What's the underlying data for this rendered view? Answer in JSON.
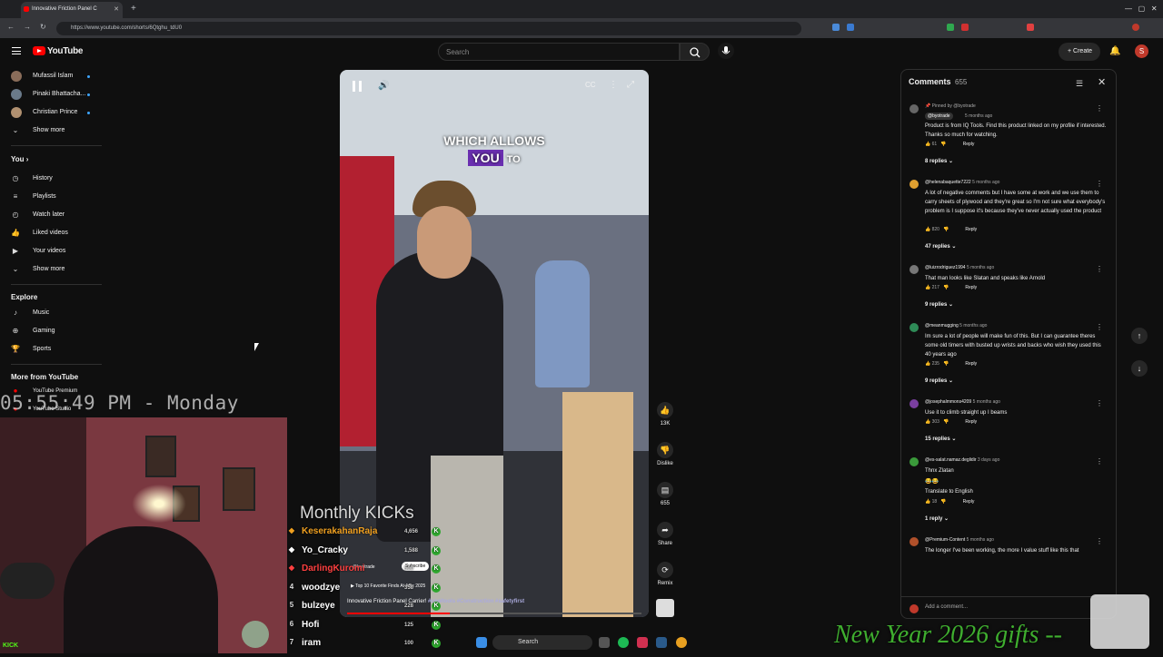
{
  "browser": {
    "tab_title": "Innovative Friction Panel C",
    "url": "https://www.youtube.com/shorts/6Qtghu_tdU0"
  },
  "header": {
    "logo_text": "YouTube",
    "search_placeholder": "Search",
    "create_label": "Create",
    "avatar_letter": "S"
  },
  "sidebar": {
    "subscriptions": [
      {
        "name": "Mufassil Islam",
        "color": "#8a6d5a"
      },
      {
        "name": "Pinaki Bhattacha...",
        "color": "#6a7a8a"
      },
      {
        "name": "Christian Prince",
        "color": "#b09070"
      }
    ],
    "show_more": "Show more",
    "you_heading": "You",
    "you_items": [
      "History",
      "Playlists",
      "Watch later",
      "Liked videos",
      "Your videos",
      "Show more"
    ],
    "explore_heading": "Explore",
    "explore_items": [
      "Music",
      "Gaming",
      "Sports"
    ],
    "more_heading": "More from YouTube",
    "more_items": [
      "YouTube Premium",
      "YouTube Studio"
    ]
  },
  "video": {
    "caption_line1": "WHICH ALLOWS",
    "caption_word": "YOU",
    "caption_word2": "TO",
    "channel": "@byotrade",
    "subscribe": "Subscribe",
    "music": "Top 10 Favorite Finds At Affix 2025",
    "title": "Innovative Friction Panel Carrier!",
    "hashtags": "#cooltools #Construction #safetyfirst",
    "progress": 0.35
  },
  "actions": {
    "like_count": "13K",
    "dislike_label": "Dislike",
    "comment_count": "655",
    "share_label": "Share",
    "remix_label": "Remix"
  },
  "comments": {
    "heading": "Comments",
    "count": "655",
    "items": [
      {
        "author": "@byotrade",
        "pinned": "Pinned by @byotrade",
        "time": "5 months ago",
        "text": "Product is from IQ Tools. Find this product linked on my profile if interested. Thanks so much for watching.",
        "likes": "61",
        "replies": "8 replies",
        "color": "#666"
      },
      {
        "author": "@helenabaquette7222",
        "time": "5 months ago",
        "text": "A lot of negative comments but I have some at work and we use them to carry sheets of plywood and they're great so I'm not sure what everybody's problem is I suppose it's because they've never actually used the product",
        "likes": "820",
        "replies": "47 replies",
        "color": "#e0a030"
      },
      {
        "author": "@luizrodriguez1994",
        "time": "5 months ago",
        "text": "That man looks like Slatan and speaks like Arnold",
        "likes": "217",
        "replies": "9 replies",
        "color": "#777"
      },
      {
        "author": "@meanmugging",
        "time": "5 months ago",
        "text": "Im sure a lot of people will make fun of this. But I can guarantee theres some old timers with busted up wrists and backs who wish they used this 40 years ago",
        "likes": "235",
        "replies": "9 replies",
        "color": "#2e8b57"
      },
      {
        "author": "@josephalmmons4209",
        "time": "5 months ago",
        "text": "Use it to climb straight up I beams",
        "likes": "303",
        "replies": "15 replies",
        "color": "#7b3fa0"
      },
      {
        "author": "@es-salat.namaz.deglidir",
        "time": "3 days ago",
        "text": "Thnx Zlatan",
        "emoji": "😂😂",
        "translate": "Translate to English",
        "likes": "18",
        "replies": "1 reply",
        "color": "#3a9a3a"
      },
      {
        "author": "@Premium-Content",
        "time": "5 months ago",
        "text": "The longer I've been working, the more I value stuff like this that",
        "color": "#b0502a"
      }
    ],
    "reply_label": "Reply",
    "add_comment": "Add a comment..."
  },
  "overlay": {
    "clock": "05:55:49 PM - Monday",
    "kick_title": "Monthly KICKs",
    "leaderboard": [
      {
        "rank": "",
        "name": "KeserakahanRaja",
        "amount": "4,656",
        "color": "#f0a020"
      },
      {
        "rank": "",
        "name": "Yo_Cracky",
        "amount": "1,588",
        "color": "#ffffff"
      },
      {
        "rank": "",
        "name": "DarlingKuromi",
        "amount": "500",
        "color": "#ff4040"
      },
      {
        "rank": "4",
        "name": "woodzye",
        "amount": "358",
        "color": "#ffffff"
      },
      {
        "rank": "5",
        "name": "bulzeye",
        "amount": "228",
        "color": "#ffffff"
      },
      {
        "rank": "6",
        "name": "Hofi",
        "amount": "125",
        "color": "#ffffff"
      },
      {
        "rank": "7",
        "name": "iram",
        "amount": "100",
        "color": "#ffffff"
      }
    ],
    "new_year": "New Year 2026 gifts --",
    "kick_badge": "KICK"
  },
  "taskbar": {
    "search": "Search"
  }
}
